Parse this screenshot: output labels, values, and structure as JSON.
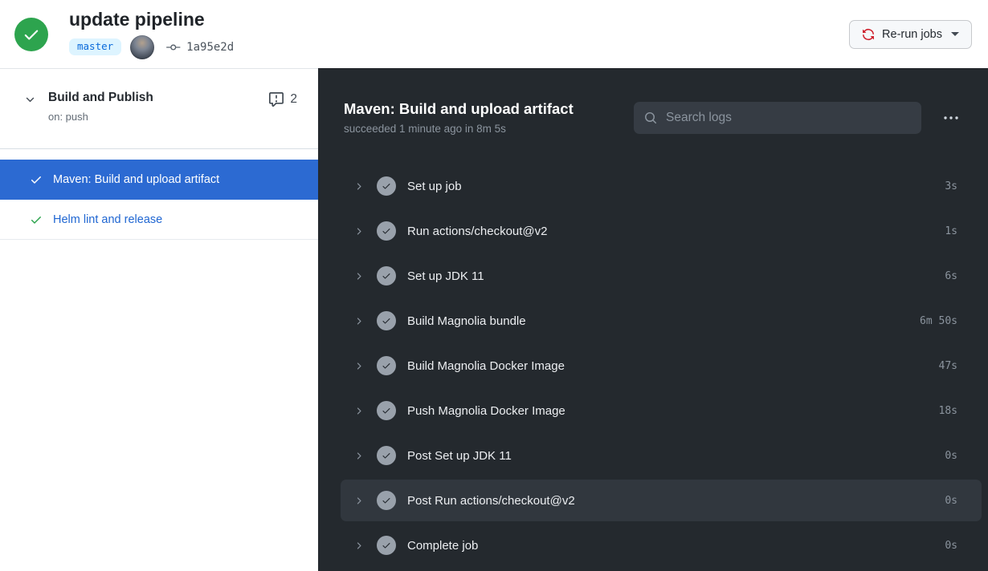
{
  "header": {
    "title": "update pipeline",
    "branch": "master",
    "commit_sha": "1a95e2d",
    "rerun_label": "Re-run jobs"
  },
  "sidebar": {
    "workflow": {
      "name": "Build and Publish",
      "trigger": "on: push",
      "annotations_count": "2"
    },
    "jobs": [
      {
        "label": "Maven: Build and upload artifact",
        "selected": true
      },
      {
        "label": "Helm lint and release",
        "selected": false
      }
    ]
  },
  "panel": {
    "job_title": "Maven: Build and upload artifact",
    "job_subtitle": "succeeded 1 minute ago in 8m 5s",
    "search_placeholder": "Search logs",
    "steps": [
      {
        "name": "Set up job",
        "duration": "3s"
      },
      {
        "name": "Run actions/checkout@v2",
        "duration": "1s"
      },
      {
        "name": "Set up JDK 11",
        "duration": "6s"
      },
      {
        "name": "Build Magnolia bundle",
        "duration": "6m 50s"
      },
      {
        "name": "Build Magnolia Docker Image",
        "duration": "47s"
      },
      {
        "name": "Push Magnolia Docker Image",
        "duration": "18s"
      },
      {
        "name": "Post Set up JDK 11",
        "duration": "0s"
      },
      {
        "name": "Post Run actions/checkout@v2",
        "duration": "0s",
        "highlighted": true
      },
      {
        "name": "Complete job",
        "duration": "0s"
      }
    ]
  },
  "colors": {
    "success_green": "#2da44e",
    "selected_blue": "#2c6ad2",
    "link_blue": "#1f66d2",
    "rerun_icon_red": "#cf222e",
    "panel_bg": "#24292e",
    "branch_badge_bg": "#ddf4ff",
    "branch_badge_text": "#0969da"
  }
}
